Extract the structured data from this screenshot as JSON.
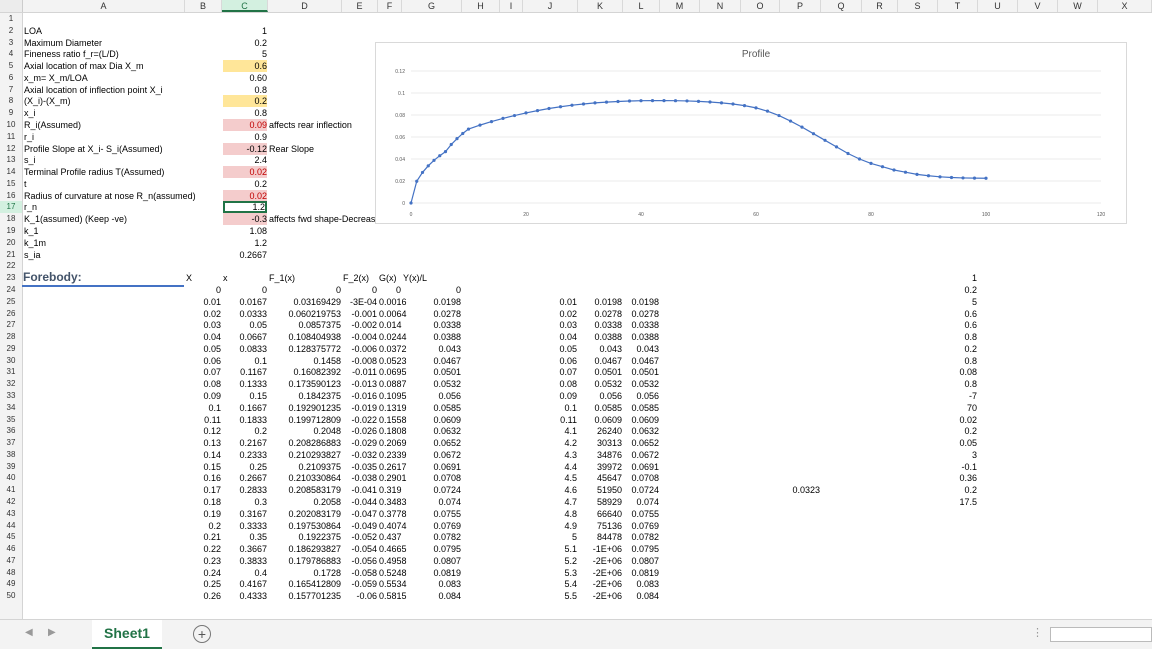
{
  "columns": [
    "A",
    "B",
    "C",
    "D",
    "E",
    "F",
    "G",
    "H",
    "I",
    "J",
    "K",
    "L",
    "M",
    "N",
    "O",
    "P",
    "Q",
    "R",
    "S",
    "T",
    "U",
    "V",
    "W",
    "X"
  ],
  "selected_column": "C",
  "rows": [
    "1",
    "2",
    "3",
    "4",
    "5",
    "6",
    "7",
    "8",
    "9",
    "10",
    "11",
    "12",
    "13",
    "14",
    "15",
    "16",
    "17",
    "18",
    "19",
    "20",
    "21",
    "22",
    "23",
    "24",
    "25",
    "26",
    "27",
    "28",
    "29",
    "30",
    "31",
    "32",
    "33",
    "34",
    "35",
    "36",
    "37",
    "38",
    "39",
    "40",
    "41",
    "42",
    "43",
    "44",
    "45",
    "46",
    "47",
    "48",
    "49",
    "50"
  ],
  "selected_row": "17",
  "params": {
    "labels": [
      "LOA",
      "Maximum Diameter",
      "Fineness ratio f_r=(L/D)",
      "Axial location of max Dia X_m",
      "x_m= X_m/LOA",
      "Axial location of inflection point X_i",
      "(X_i)-(X_m)",
      "x_i",
      "R_i(Assumed)",
      "r_i",
      "Profile Slope at X_i- S_i(Assumed)",
      "s_i",
      "Terminal Profile radius T(Assumed)",
      "t",
      "Radius of curvature at nose R_n(assumed)",
      "r_n",
      "K_1(assumed) (Keep -ve)",
      "k_1",
      "k_1m",
      "s_ia"
    ],
    "values": [
      "1",
      "0.2",
      "5",
      "0.6",
      "0.60",
      "0.8",
      "0.2",
      "0.8",
      "0.09",
      "0.9",
      "-0.12",
      "2.4",
      "0.02",
      "0.2",
      "0.02",
      "1.2",
      "-0.3",
      "1.08",
      "1.2",
      "0.2667"
    ],
    "notes": {
      "r10": "affects rear inflection",
      "r12": "Rear Slope",
      "r18": "affects fwd shape-Decreasing the value decreases the offsets in fwd region"
    }
  },
  "forebody_title": "Forebody:",
  "headers": {
    "B": "X",
    "C": "x",
    "D": "F_1(x)",
    "E": "F_2(x)",
    "F": "G(x)",
    "G": "Y(x)/L"
  },
  "table": {
    "B": [
      "0",
      "0.01",
      "0.02",
      "0.03",
      "0.04",
      "0.05",
      "0.06",
      "0.07",
      "0.08",
      "0.09",
      "0.1",
      "0.11",
      "0.12",
      "0.13",
      "0.14",
      "0.15",
      "0.16",
      "0.17",
      "0.18",
      "0.19",
      "0.2",
      "0.21",
      "0.22",
      "0.23",
      "0.24",
      "0.25",
      "0.26"
    ],
    "C": [
      "0",
      "0.0167",
      "0.0333",
      "0.05",
      "0.0667",
      "0.0833",
      "0.1",
      "0.1167",
      "0.1333",
      "0.15",
      "0.1667",
      "0.1833",
      "0.2",
      "0.2167",
      "0.2333",
      "0.25",
      "0.2667",
      "0.2833",
      "0.3",
      "0.3167",
      "0.3333",
      "0.35",
      "0.3667",
      "0.3833",
      "0.4",
      "0.4167",
      "0.4333"
    ],
    "D": [
      "0",
      "0.03169429",
      "0.060219753",
      "0.0857375",
      "0.108404938",
      "0.128375772",
      "0.1458",
      "0.16082392",
      "0.173590123",
      "0.1842375",
      "0.192901235",
      "0.199712809",
      "0.2048",
      "0.208286883",
      "0.210293827",
      "0.2109375",
      "0.210330864",
      "0.208583179",
      "0.2058",
      "0.202083179",
      "0.197530864",
      "0.1922375",
      "0.186293827",
      "0.179786883",
      "0.1728",
      "0.165412809",
      "0.157701235"
    ],
    "E": [
      "0",
      "-3E-04",
      "-0.001",
      "-0.002",
      "-0.004",
      "-0.006",
      "-0.008",
      "-0.011",
      "-0.013",
      "-0.016",
      "-0.019",
      "-0.022",
      "-0.026",
      "-0.029",
      "-0.032",
      "-0.035",
      "-0.038",
      "-0.041",
      "-0.044",
      "-0.047",
      "-0.049",
      "-0.052",
      "-0.054",
      "-0.056",
      "-0.058",
      "-0.059",
      "-0.06"
    ],
    "F": [
      "0",
      "0.0016",
      "0.0064",
      "0.014",
      "0.0244",
      "0.0372",
      "0.0523",
      "0.0695",
      "0.0887",
      "0.1095",
      "0.1319",
      "0.1558",
      "0.1808",
      "0.2069",
      "0.2339",
      "0.2617",
      "0.2901",
      "0.319",
      "0.3483",
      "0.3778",
      "0.4074",
      "0.437",
      "0.4665",
      "0.4958",
      "0.5248",
      "0.5534",
      "0.5815"
    ],
    "G": [
      "0",
      "0.0198",
      "0.0278",
      "0.0338",
      "0.0388",
      "0.043",
      "0.0467",
      "0.0501",
      "0.0532",
      "0.056",
      "0.0585",
      "0.0609",
      "0.0632",
      "0.0652",
      "0.0672",
      "0.0691",
      "0.0708",
      "0.0724",
      "0.074",
      "0.0755",
      "0.0769",
      "0.0782",
      "0.0795",
      "0.0807",
      "0.0819",
      "0.083",
      "0.084"
    ],
    "J": [
      "",
      "0.01",
      "0.02",
      "0.03",
      "0.04",
      "0.05",
      "0.06",
      "0.07",
      "0.08",
      "0.09",
      "0.1",
      "0.11",
      "4.1",
      "4.2",
      "4.3",
      "4.4",
      "4.5",
      "4.6",
      "4.7",
      "4.8",
      "4.9",
      "5",
      "5.1",
      "5.2",
      "5.3",
      "5.4",
      "5.5"
    ],
    "K": [
      "",
      "0.0198",
      "0.0278",
      "0.0338",
      "0.0388",
      "0.043",
      "0.0467",
      "0.0501",
      "0.0532",
      "0.056",
      "0.0585",
      "0.0609",
      "26240",
      "30313",
      "34876",
      "39972",
      "45647",
      "51950",
      "58929",
      "66640",
      "75136",
      "84478",
      "-1E+06",
      "-2E+06",
      "-2E+06",
      "-2E+06",
      "-2E+06"
    ],
    "L": [
      "",
      "0.0198",
      "0.0278",
      "0.0338",
      "0.0388",
      "0.043",
      "0.0467",
      "0.0501",
      "0.0532",
      "0.056",
      "0.0585",
      "0.0609",
      "0.0632",
      "0.0652",
      "0.0672",
      "0.0691",
      "0.0708",
      "0.0724",
      "0.074",
      "0.0755",
      "0.0769",
      "0.0782",
      "0.0795",
      "0.0807",
      "0.0819",
      "0.083",
      "0.084"
    ],
    "T": [
      "1",
      "0.2",
      "5",
      "0.6",
      "0.6",
      "0.8",
      "0.2",
      "0.8",
      "0.08",
      "0.8",
      "-7",
      "70",
      "0.02",
      "0.2",
      "0.05",
      "3",
      "-0.1",
      "0.36",
      "0.2",
      "17.5"
    ],
    "P41": "0.0323"
  },
  "chart_data": {
    "type": "scatter",
    "title": "Profile",
    "xlim": [
      0,
      120
    ],
    "ylim": [
      0,
      0.12
    ],
    "xticks": [
      "0",
      "20",
      "40",
      "60",
      "80",
      "100",
      "120"
    ],
    "yticks": [
      "0",
      "0.02",
      "0.04",
      "0.06",
      "0.08",
      "0.1",
      "0.12"
    ],
    "points_x": [
      0,
      1,
      2,
      3,
      4,
      5,
      6,
      7,
      8,
      9,
      10,
      12,
      14,
      16,
      18,
      20,
      22,
      24,
      26,
      28,
      30,
      32,
      34,
      36,
      38,
      40,
      42,
      44,
      46,
      48,
      50,
      52,
      54,
      56,
      58,
      60,
      62,
      64,
      66,
      68,
      70,
      72,
      74,
      76,
      78,
      80,
      82,
      84,
      86,
      88,
      90,
      92,
      94,
      96,
      98,
      100
    ],
    "points_y": [
      0,
      0.0198,
      0.0278,
      0.0338,
      0.0388,
      0.043,
      0.0467,
      0.0532,
      0.0585,
      0.0632,
      0.0672,
      0.0708,
      0.074,
      0.0769,
      0.0795,
      0.0819,
      0.084,
      0.0859,
      0.0875,
      0.0889,
      0.09,
      0.091,
      0.0917,
      0.0923,
      0.0927,
      0.093,
      0.0931,
      0.0931,
      0.093,
      0.0928,
      0.0924,
      0.0918,
      0.091,
      0.09,
      0.0885,
      0.0865,
      0.0835,
      0.0795,
      0.0745,
      0.069,
      0.063,
      0.057,
      0.051,
      0.045,
      0.04,
      0.036,
      0.033,
      0.03,
      0.028,
      0.026,
      0.0248,
      0.0238,
      0.0232,
      0.0228,
      0.0226,
      0.0225
    ],
    "point_color": "#4472c4",
    "grid": true
  },
  "sheet_tab": "Sheet1",
  "colors": {
    "accent": "#217346",
    "yellow": "#ffe699",
    "pink": "#f4cccc",
    "series": "#4472c4"
  }
}
